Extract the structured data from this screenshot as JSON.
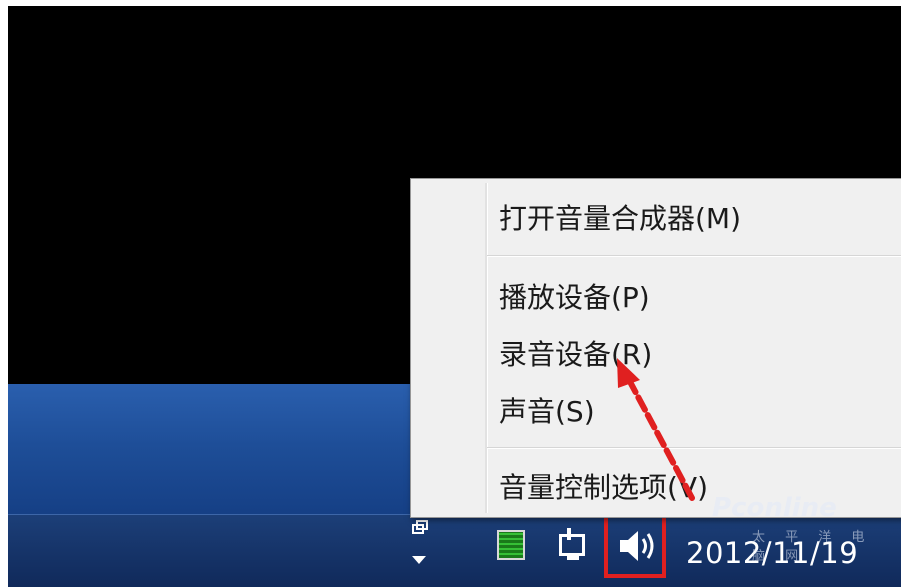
{
  "context_menu": {
    "items": [
      {
        "label": "打开音量合成器(M)"
      },
      {
        "label": "播放设备(P)"
      },
      {
        "label": "录音设备(R)"
      },
      {
        "label": "声音(S)"
      },
      {
        "label": "音量控制选项(V)"
      }
    ]
  },
  "taskbar": {
    "clock_date": "2012/11/19",
    "tray_icons": [
      "show-hidden-icons-icon",
      "green-app-icon",
      "network-icon",
      "speaker-icon"
    ]
  },
  "annotation": {
    "highlight_color": "#e02020",
    "arrow_color": "#e02020",
    "arrow_target": "录音设备(R)"
  },
  "watermark": {
    "brand": "Pconline",
    "sub": "太 平 洋 电 脑 网"
  },
  "colors": {
    "menu_bg": "#f0f0f0",
    "taskbar": "#10295a",
    "desktop_top": "#000000"
  }
}
